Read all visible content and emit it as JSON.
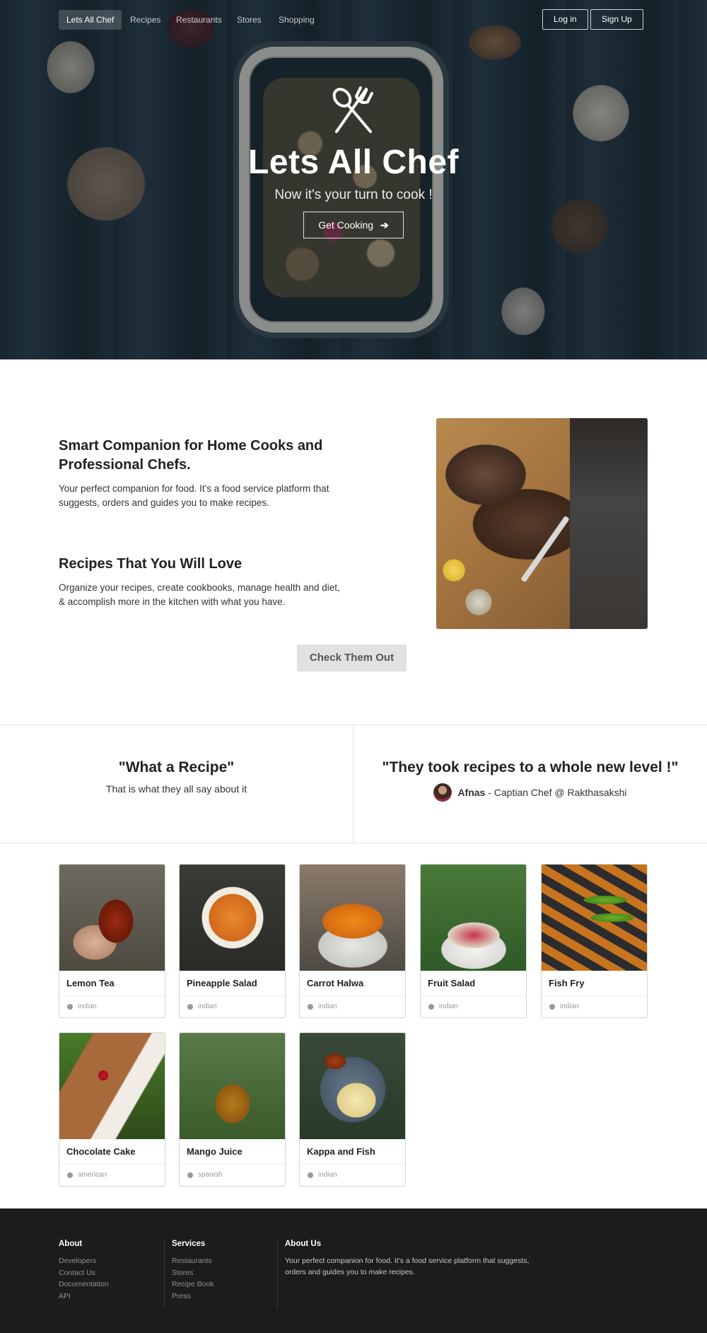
{
  "nav": {
    "brand": "Lets All Chef",
    "items": [
      "Recipes",
      "Restaurants",
      "Stores",
      "Shopping"
    ],
    "login": "Log in",
    "signup": "Sign Up"
  },
  "hero": {
    "title": "Lets All Chef",
    "subtitle": "Now it's your turn to cook !",
    "cta": "Get Cooking",
    "icon": "utensils-icon"
  },
  "features": [
    {
      "title": "Smart Companion for Home Cooks and Professional Chefs.",
      "text": "Your perfect companion for food. It's a food service platform that suggests, orders and guides you to make recipes."
    },
    {
      "title": "Recipes That You Will Love",
      "text": "Organize your recipes, create cookbooks, manage health and diet, & accomplish more in the kitchen with what you have."
    }
  ],
  "check_button": "Check Them Out",
  "testimonials": [
    {
      "quote": "\"What a Recipe\"",
      "subtitle": "That is what they all say about it"
    },
    {
      "quote": "\"They took recipes to a whole new level !\"",
      "author": "Afnas",
      "role": " - Captian Chef @ Rakthasakshi"
    }
  ],
  "recipes": [
    {
      "name": "Lemon Tea",
      "cuisine": "indian"
    },
    {
      "name": "Pineapple Salad",
      "cuisine": "indian"
    },
    {
      "name": "Carrot Halwa",
      "cuisine": "indian"
    },
    {
      "name": "Fruit Salad",
      "cuisine": "indian"
    },
    {
      "name": "Fish Fry",
      "cuisine": "indian"
    },
    {
      "name": "Chocolate Cake",
      "cuisine": "american"
    },
    {
      "name": "Mango Juice",
      "cuisine": "spanish"
    },
    {
      "name": "Kappa and Fish",
      "cuisine": "indian"
    }
  ],
  "footer": {
    "about": {
      "title": "About",
      "links": [
        "Developers",
        "Contact Us",
        "Documentation",
        "API"
      ]
    },
    "services": {
      "title": "Services",
      "links": [
        "Restaurants",
        "Stores",
        "Recipe Book",
        "Press"
      ]
    },
    "about_us": {
      "title": "About Us",
      "text": "Your perfect companion for food. It's a food service platform that suggests, orders and guides you to make recipes."
    }
  },
  "colors": {
    "hero_overlay": "#22323c",
    "footer_bg": "#1b1c1d",
    "button_gray": "#e0e1e2"
  }
}
